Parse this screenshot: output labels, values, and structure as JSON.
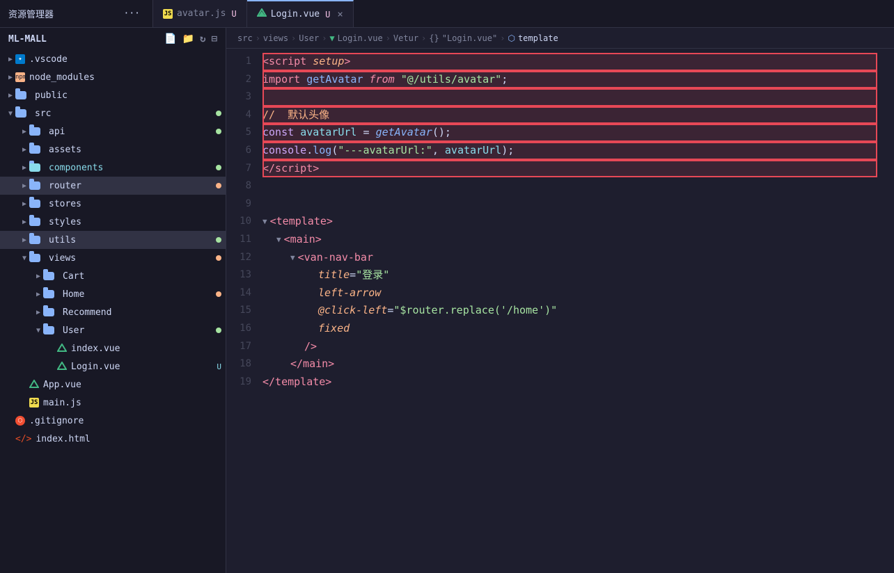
{
  "tabbar": {
    "title": "资源管理器",
    "dots": "···",
    "tabs": [
      {
        "id": "avatar",
        "lang_icon": "JS",
        "label": "avatar.js",
        "dirty": "U",
        "active": false
      },
      {
        "id": "login",
        "lang_icon": "Vue",
        "label": "Login.vue",
        "dirty": "U",
        "active": true
      }
    ]
  },
  "breadcrumb": {
    "parts": [
      "src",
      ">",
      "views",
      ">",
      "User",
      ">",
      "Login.vue",
      ">",
      "Vetur",
      ">",
      "{}",
      "\"Login.vue\"",
      ">",
      "template"
    ]
  },
  "sidebar": {
    "root": "ML-MALL",
    "actions": [
      "new-file",
      "new-folder",
      "refresh",
      "collapse"
    ],
    "items": [
      {
        "id": "vscode",
        "label": ".vscode",
        "type": "folder",
        "depth": 1,
        "expanded": false
      },
      {
        "id": "node_modules",
        "label": "node_modules",
        "type": "folder",
        "depth": 1,
        "expanded": false
      },
      {
        "id": "public",
        "label": "public",
        "type": "folder",
        "depth": 1,
        "expanded": false
      },
      {
        "id": "src",
        "label": "src",
        "type": "folder",
        "depth": 1,
        "expanded": true,
        "badge": "green"
      },
      {
        "id": "api",
        "label": "api",
        "type": "folder",
        "depth": 2,
        "expanded": false,
        "badge": "green"
      },
      {
        "id": "assets",
        "label": "assets",
        "type": "folder",
        "depth": 2,
        "expanded": false
      },
      {
        "id": "components",
        "label": "components",
        "type": "folder",
        "depth": 2,
        "expanded": false,
        "badge": "green"
      },
      {
        "id": "router",
        "label": "router",
        "type": "folder",
        "depth": 2,
        "expanded": false,
        "badge": "orange"
      },
      {
        "id": "stores",
        "label": "stores",
        "type": "folder",
        "depth": 2,
        "expanded": false
      },
      {
        "id": "styles",
        "label": "styles",
        "type": "folder",
        "depth": 2,
        "expanded": false
      },
      {
        "id": "utils",
        "label": "utils",
        "type": "folder",
        "depth": 2,
        "expanded": false,
        "active": true,
        "badge": "green"
      },
      {
        "id": "views",
        "label": "views",
        "type": "folder",
        "depth": 2,
        "expanded": true,
        "badge": "orange"
      },
      {
        "id": "cart",
        "label": "Cart",
        "type": "folder",
        "depth": 3,
        "expanded": false
      },
      {
        "id": "home",
        "label": "Home",
        "type": "folder",
        "depth": 3,
        "expanded": false,
        "badge": "orange"
      },
      {
        "id": "recommend",
        "label": "Recommend",
        "type": "folder",
        "depth": 3,
        "expanded": false
      },
      {
        "id": "user",
        "label": "User",
        "type": "folder",
        "depth": 3,
        "expanded": true,
        "badge": "green"
      },
      {
        "id": "index-vue",
        "label": "index.vue",
        "type": "vue",
        "depth": 4
      },
      {
        "id": "login-vue",
        "label": "Login.vue",
        "type": "vue",
        "depth": 4,
        "badge_u": "U"
      },
      {
        "id": "app-vue",
        "label": "App.vue",
        "type": "vue",
        "depth": 2
      },
      {
        "id": "main-js",
        "label": "main.js",
        "type": "js",
        "depth": 2
      },
      {
        "id": "gitignore",
        "label": ".gitignore",
        "type": "git",
        "depth": 1
      },
      {
        "id": "index-html",
        "label": "index.html",
        "type": "html",
        "depth": 1
      }
    ]
  },
  "editor": {
    "lines": [
      {
        "num": 1,
        "highlight": true
      },
      {
        "num": 2,
        "highlight": true
      },
      {
        "num": 3,
        "highlight": true
      },
      {
        "num": 4,
        "highlight": true
      },
      {
        "num": 5,
        "highlight": true
      },
      {
        "num": 6,
        "highlight": true
      },
      {
        "num": 7,
        "highlight": true
      },
      {
        "num": 8,
        "highlight": false
      },
      {
        "num": 9,
        "highlight": false
      },
      {
        "num": 10,
        "highlight": false
      },
      {
        "num": 11,
        "highlight": false
      },
      {
        "num": 12,
        "highlight": false
      },
      {
        "num": 13,
        "highlight": false
      },
      {
        "num": 14,
        "highlight": false
      },
      {
        "num": 15,
        "highlight": false
      },
      {
        "num": 16,
        "highlight": false
      },
      {
        "num": 17,
        "highlight": false
      },
      {
        "num": 18,
        "highlight": false
      },
      {
        "num": 19,
        "highlight": false
      }
    ]
  }
}
